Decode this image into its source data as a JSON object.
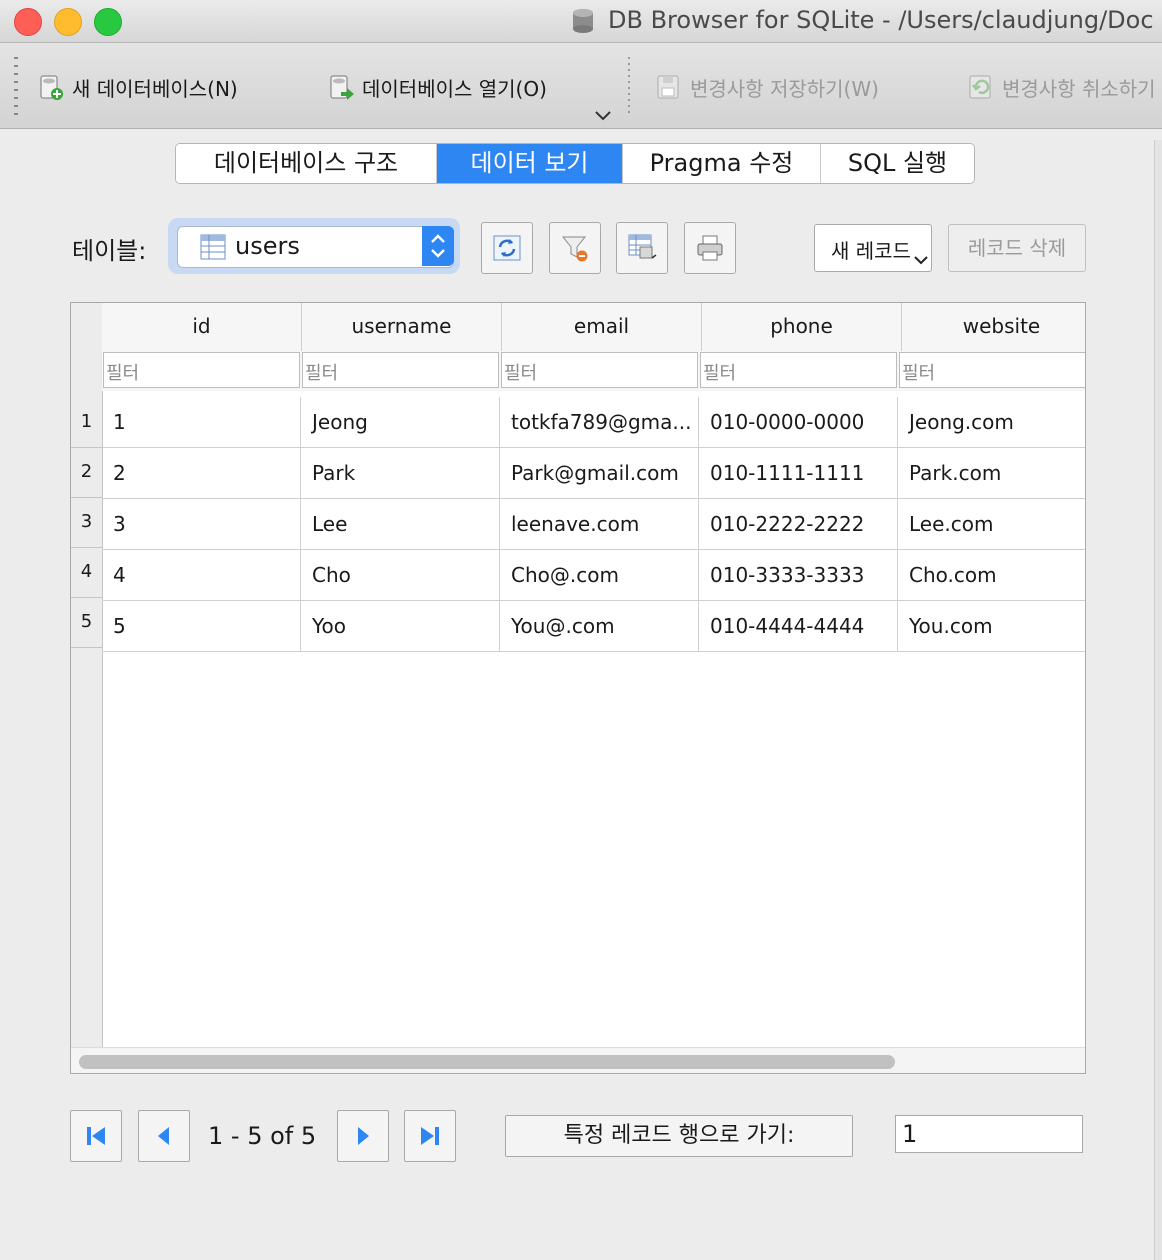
{
  "window": {
    "title": "DB Browser for SQLite - /Users/claudjung/Doc"
  },
  "toolbar": {
    "new_db": "새 데이터베이스(N)",
    "open_db": "데이터베이스 열기(O)",
    "save_changes": "변경사항 저장하기(W)",
    "revert_changes": "변경사항 취소하기"
  },
  "tabs": [
    {
      "label": "데이터베이스 구조",
      "active": false
    },
    {
      "label": "데이터 보기",
      "active": true
    },
    {
      "label": "Pragma 수정",
      "active": false
    },
    {
      "label": "SQL 실행",
      "active": false
    }
  ],
  "table_selector": {
    "label": "테이블:",
    "value": "users"
  },
  "record_buttons": {
    "new_record": "새 레코드",
    "delete_record": "레코드 삭제"
  },
  "grid": {
    "columns": [
      "id",
      "username",
      "email",
      "phone",
      "website"
    ],
    "filter_placeholder": "필터",
    "row_numbers": [
      "1",
      "2",
      "3",
      "4",
      "5"
    ],
    "rows": [
      [
        "1",
        "Jeong",
        "totkfa789@gma...",
        "010-0000-0000",
        "Jeong.com"
      ],
      [
        "2",
        "Park",
        "Park@gmail.com",
        "010-1111-1111",
        "Park.com"
      ],
      [
        "3",
        "Lee",
        "leenave.com",
        "010-2222-2222",
        "Lee.com"
      ],
      [
        "4",
        "Cho",
        "Cho@.com",
        "010-3333-3333",
        "Cho.com"
      ],
      [
        "5",
        "Yoo",
        "You@.com",
        "010-4444-4444",
        "You.com"
      ]
    ]
  },
  "pagination": {
    "info": "1 - 5 of 5",
    "goto_label": "특정 레코드 행으로 가기:",
    "goto_value": "1"
  },
  "colors": {
    "accent": "#2d86f2",
    "close": "#fd5f57",
    "minimize": "#febc2e",
    "maximize": "#28c840"
  }
}
